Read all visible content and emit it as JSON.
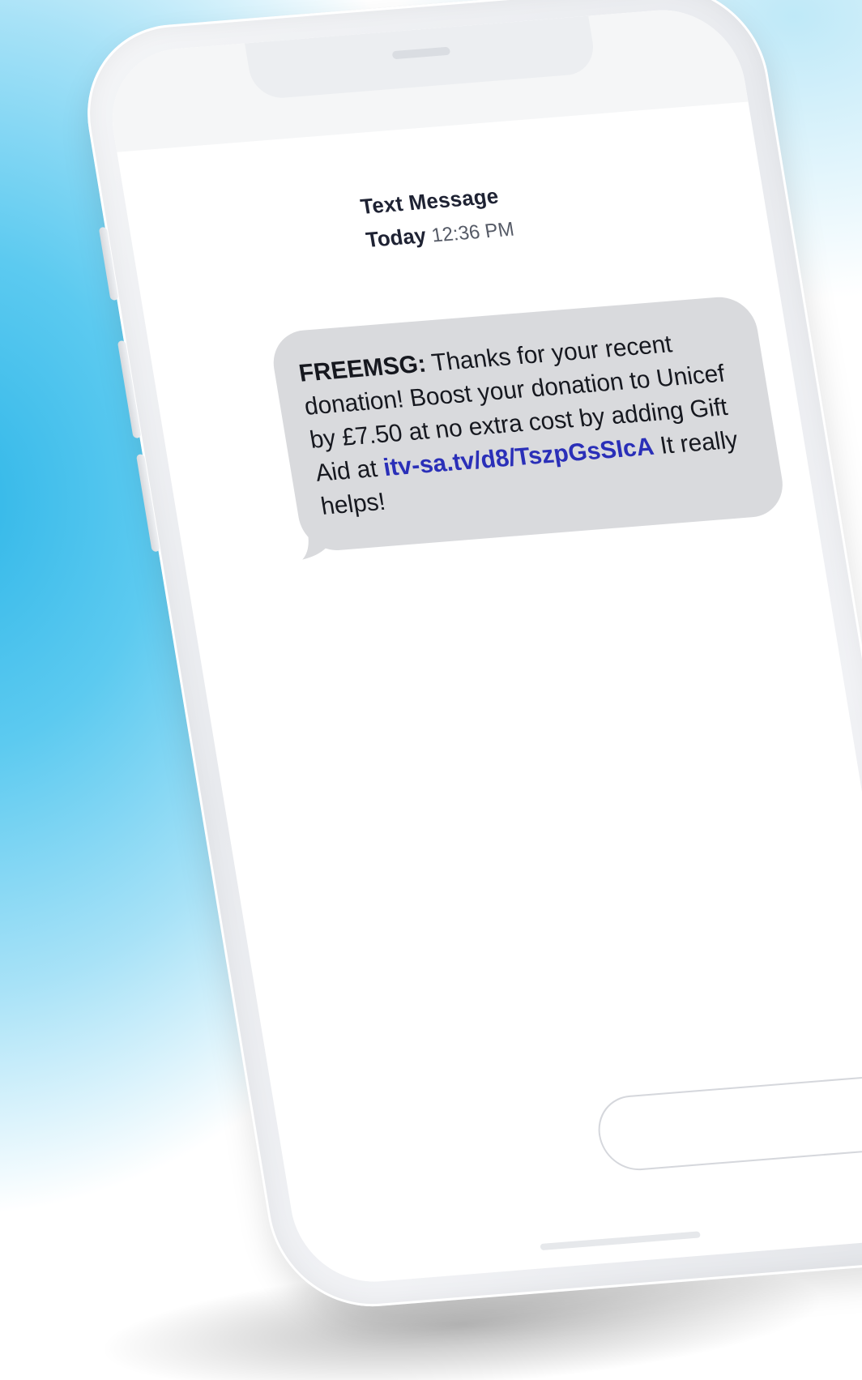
{
  "conversation": {
    "title": "Text Message",
    "day": "Today",
    "time": "12:36 PM"
  },
  "message": {
    "sender": "FREEMSG:",
    "text_before_link": " Thanks for your recent donation! Boost your donation to Unicef by £7.50 at no extra cost by adding Gift Aid at ",
    "link": "itv-sa.tv/d8/TszpGsSIcA",
    "text_after_link": " It really helps!"
  },
  "composer": {
    "placeholder": "",
    "send_icon": "send-icon"
  },
  "colors": {
    "bubble": "#d9dadd",
    "link": "#2a2fb8",
    "send_button": "#2c2fcf",
    "background_accent": "#2fb6e8"
  }
}
